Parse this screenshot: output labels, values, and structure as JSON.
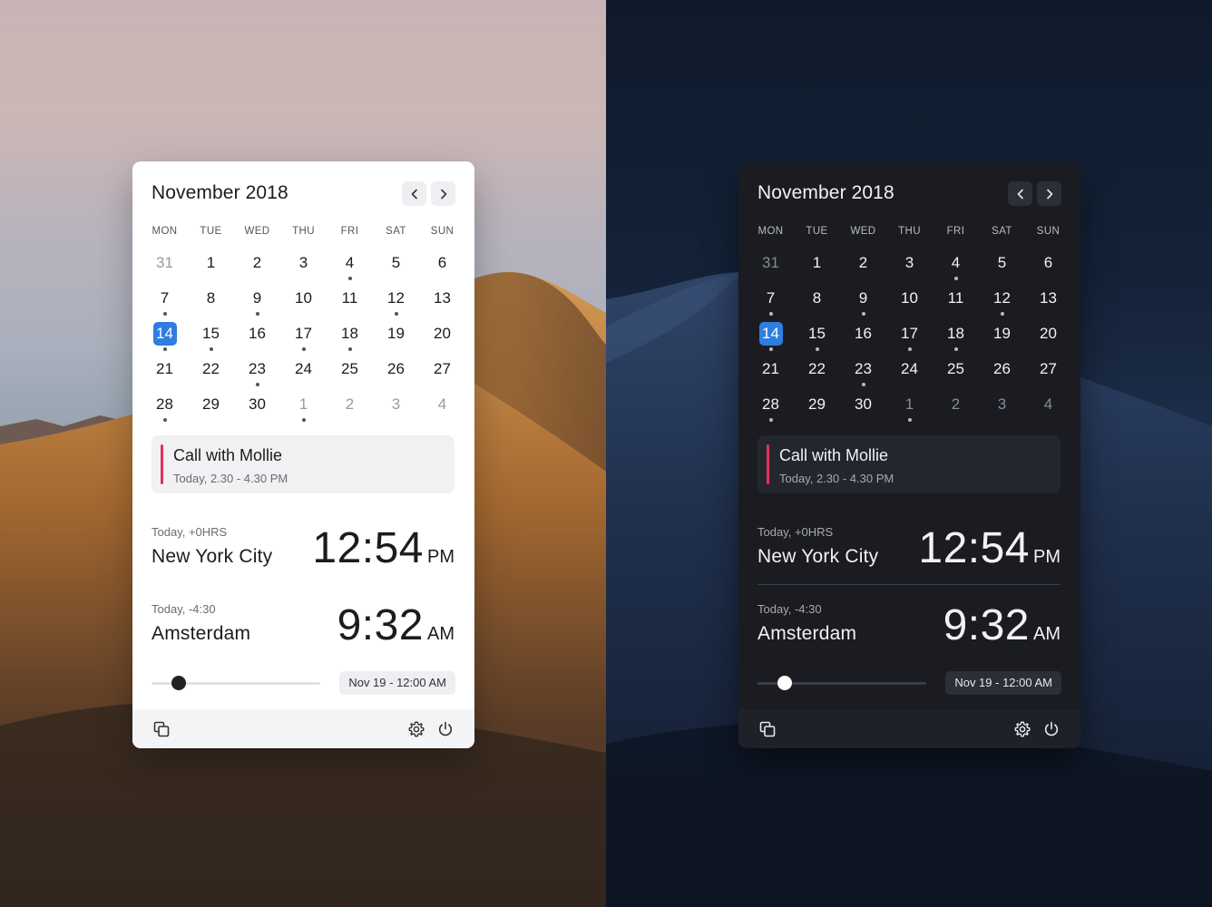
{
  "calendar": {
    "month_title": "November 2018",
    "weekdays": [
      "MON",
      "TUE",
      "WED",
      "THU",
      "FRI",
      "SAT",
      "SUN"
    ],
    "days": [
      {
        "n": "31",
        "muted": true,
        "dot": false
      },
      {
        "n": "1",
        "dot": false
      },
      {
        "n": "2",
        "dot": false
      },
      {
        "n": "3",
        "dot": false
      },
      {
        "n": "4",
        "dot": true
      },
      {
        "n": "5",
        "dot": false
      },
      {
        "n": "6",
        "dot": false
      },
      {
        "n": "7",
        "dot": true
      },
      {
        "n": "8",
        "dot": false
      },
      {
        "n": "9",
        "dot": true
      },
      {
        "n": "10",
        "dot": false
      },
      {
        "n": "11",
        "dot": false
      },
      {
        "n": "12",
        "dot": true
      },
      {
        "n": "13",
        "dot": false
      },
      {
        "n": "14",
        "dot": true,
        "today": true
      },
      {
        "n": "15",
        "dot": true
      },
      {
        "n": "16",
        "dot": false
      },
      {
        "n": "17",
        "dot": true
      },
      {
        "n": "18",
        "dot": true
      },
      {
        "n": "19",
        "dot": false
      },
      {
        "n": "20",
        "dot": false
      },
      {
        "n": "21",
        "dot": false
      },
      {
        "n": "22",
        "dot": false
      },
      {
        "n": "23",
        "dot": true
      },
      {
        "n": "24",
        "dot": false
      },
      {
        "n": "25",
        "dot": false
      },
      {
        "n": "26",
        "dot": false
      },
      {
        "n": "27",
        "dot": false
      },
      {
        "n": "28",
        "dot": true
      },
      {
        "n": "29",
        "dot": false
      },
      {
        "n": "30",
        "dot": false
      },
      {
        "n": "1",
        "muted": true,
        "dot": true
      },
      {
        "n": "2",
        "muted": true,
        "dot": false
      },
      {
        "n": "3",
        "muted": true,
        "dot": false
      },
      {
        "n": "4",
        "muted": true,
        "dot": false
      }
    ]
  },
  "event": {
    "title": "Call with Mollie",
    "time": "Today, 2.30 - 4.30 PM",
    "accent": "#e0345a"
  },
  "cities": [
    {
      "sub": "Today, +0HRS",
      "name": "New York City",
      "time": "12:54",
      "ampm": "PM"
    },
    {
      "sub": "Today, -4:30",
      "name": "Amsterdam",
      "time": "9:32",
      "ampm": "AM"
    }
  ],
  "slider": {
    "position_fraction": 0.16
  },
  "date_chip": "Nov 19 - 12:00 AM",
  "footer_icons": [
    "copy-icon",
    "gear-icon",
    "power-icon"
  ],
  "colors": {
    "today_highlight": "#2f7de1",
    "light_bg": "#ffffff",
    "dark_bg": "#1a1c22"
  }
}
